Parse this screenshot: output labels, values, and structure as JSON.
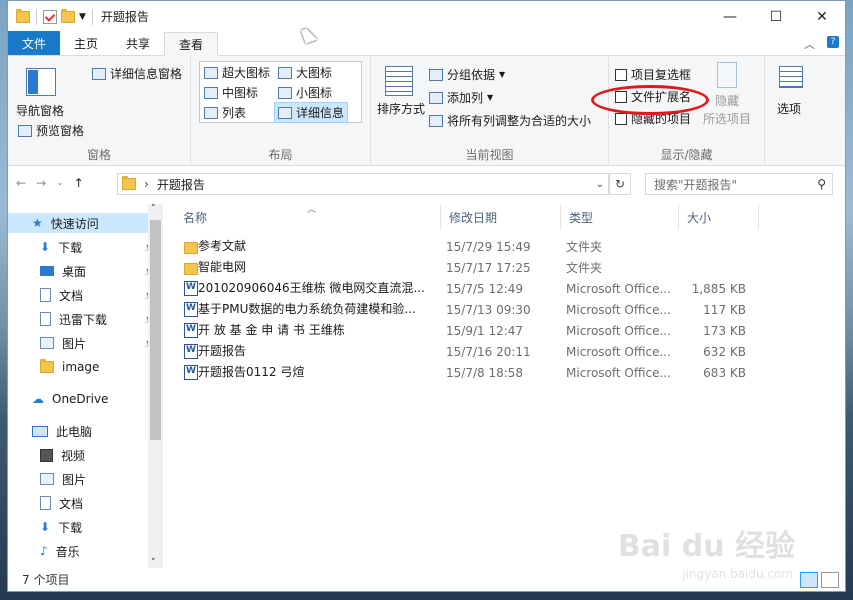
{
  "window": {
    "title": "开题报告",
    "buttons": {
      "minimize": "—",
      "maximize": "☐",
      "close": "✕"
    }
  },
  "ribbon_tabs": [
    {
      "label": "文件"
    },
    {
      "label": "主页"
    },
    {
      "label": "共享"
    },
    {
      "label": "查看"
    }
  ],
  "ribbon": {
    "panes": {
      "nav_pane": "导航窗格",
      "preview_pane": "预览窗格",
      "details_pane": "详细信息窗格",
      "group_label": "窗格"
    },
    "layout": {
      "items": [
        "超大图标",
        "大图标",
        "中图标",
        "小图标",
        "列表",
        "详细信息"
      ],
      "group_label": "布局"
    },
    "current_view": {
      "sort": "排序方式",
      "group_by": "分组依据",
      "add_column": "添加列",
      "fit_columns": "将所有列调整为合适的大小",
      "group_label": "当前视图"
    },
    "show_hide": {
      "item_checkbox": "项目复选框",
      "file_ext": "文件扩展名",
      "hidden_items": "隐藏的项目",
      "hide": "隐藏",
      "hide_selected": "所选项目",
      "group_label": "显示/隐藏"
    },
    "options": "选项"
  },
  "address": {
    "path": "开题报告",
    "search_placeholder": "搜索\"开题报告\""
  },
  "nav": {
    "quick_access": "快速访问",
    "items": [
      "下载",
      "桌面",
      "文档",
      "迅雷下载",
      "图片",
      "image"
    ],
    "onedrive": "OneDrive",
    "this_pc": "此电脑",
    "pc_items": [
      "视频",
      "图片",
      "文档",
      "下载",
      "音乐"
    ]
  },
  "columns": {
    "name": "名称",
    "date": "修改日期",
    "type": "类型",
    "size": "大小"
  },
  "files": [
    {
      "name": "参考文献",
      "date": "15/7/29 15:49",
      "type": "文件夹",
      "size": "",
      "kind": "folder"
    },
    {
      "name": "智能电网",
      "date": "15/7/17 17:25",
      "type": "文件夹",
      "size": "",
      "kind": "folder"
    },
    {
      "name": "201020906046王维栋 微电网交直流混...",
      "date": "15/7/5 12:49",
      "type": "Microsoft Office...",
      "size": "1,885 KB",
      "kind": "word"
    },
    {
      "name": "基于PMU数据的电力系统负荷建模和验...",
      "date": "15/7/13 09:30",
      "type": "Microsoft Office...",
      "size": "117 KB",
      "kind": "word"
    },
    {
      "name": "开 放 基 金 申 请 书  王维栋",
      "date": "15/9/1 12:47",
      "type": "Microsoft Office...",
      "size": "173 KB",
      "kind": "word"
    },
    {
      "name": "开题报告",
      "date": "15/7/16 20:11",
      "type": "Microsoft Office...",
      "size": "632 KB",
      "kind": "word"
    },
    {
      "name": "开题报告0112 弓煊",
      "date": "15/7/8 18:58",
      "type": "Microsoft Office...",
      "size": "683 KB",
      "kind": "word"
    }
  ],
  "status": {
    "count": "7 个项目"
  },
  "watermark": {
    "brand": "Bai du 经验",
    "url": "jingyan.baidu.com"
  }
}
